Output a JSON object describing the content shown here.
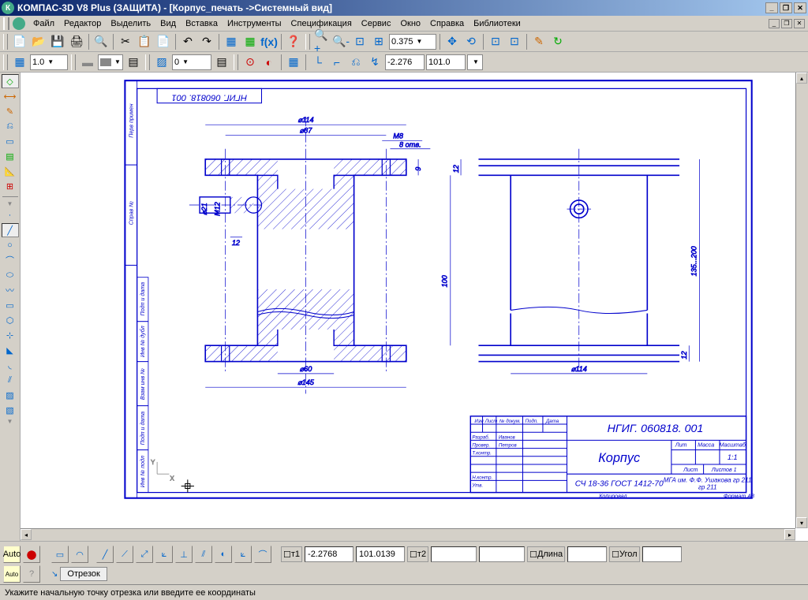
{
  "title": "КОМПАС-3D V8 Plus (ЗАЩИТА) - [Корпус_печать ->Системный вид]",
  "menu": {
    "file": "Файл",
    "editor": "Редактор",
    "select": "Выделить",
    "view": "Вид",
    "insert": "Вставка",
    "tools": "Инструменты",
    "spec": "Спецификация",
    "service": "Сервис",
    "window": "Окно",
    "help": "Справка",
    "lib": "Библиотеки"
  },
  "toolbar1": {
    "zoomcombo": "0.375"
  },
  "toolbar2": {
    "scale": "1.0",
    "layer": "0",
    "coord_x": "-2.276",
    "coord_y": "101.0"
  },
  "props": {
    "t1_label": "т1",
    "t1_x": "-2.2768",
    "t1_y": "101.0139",
    "t2_label": "т2",
    "len_label": "Длина",
    "ang_label": "Угол",
    "tab": "Отрезок"
  },
  "status": "Укажите начальную точку отрезка или введите ее координаты",
  "drawing": {
    "titleblock": {
      "code": "НГИГ. 060818. 001",
      "name": "Корпус",
      "material": "СЧ 18-36 ГОСТ 1412-70",
      "org": "МГА им. Ф.Ф. Ушакова гр 211",
      "mass": "Масса",
      "scale_lbl": "Масштаб",
      "scale": "1:1",
      "sheet": "Лист",
      "sheets": "Листов 1",
      "format": "Формат   А3",
      "lit": "Лит"
    },
    "tb_cols": {
      "izm": "Изм",
      "list": "Лист",
      "ndok": "№ докум.",
      "podp": "Подп.",
      "data": "Дата"
    },
    "tb_rows": {
      "razrab": "Разраб.",
      "prov": "Провер.",
      "tkontr": "Т.контр.",
      "nkontr": "Н.контр.",
      "utv": "Утв."
    },
    "tb_names": {
      "n1": "Иванов",
      "n2": "Петров"
    },
    "side_labels": {
      "a": "Справ №",
      "b": "Перв примен",
      "c": "Подп и дата",
      "d": "Инв № дубл",
      "e": "Взам инв №",
      "f": "Подп и дата",
      "g": "Инв № подл"
    },
    "topcode": "НГИГ. 060818. 001",
    "dims": {
      "d114": "⌀114",
      "d87": "⌀87",
      "M8": "M8",
      "otv8": "8 отв.",
      "n9": "9",
      "n12l": "12",
      "n12r": "12",
      "d21": "⌀21",
      "M12": "M12",
      "n12bot": "12",
      "d60": "⌀60",
      "d145": "⌀145",
      "n100": "100",
      "n135": "135...200",
      "d114b": "⌀114"
    }
  }
}
